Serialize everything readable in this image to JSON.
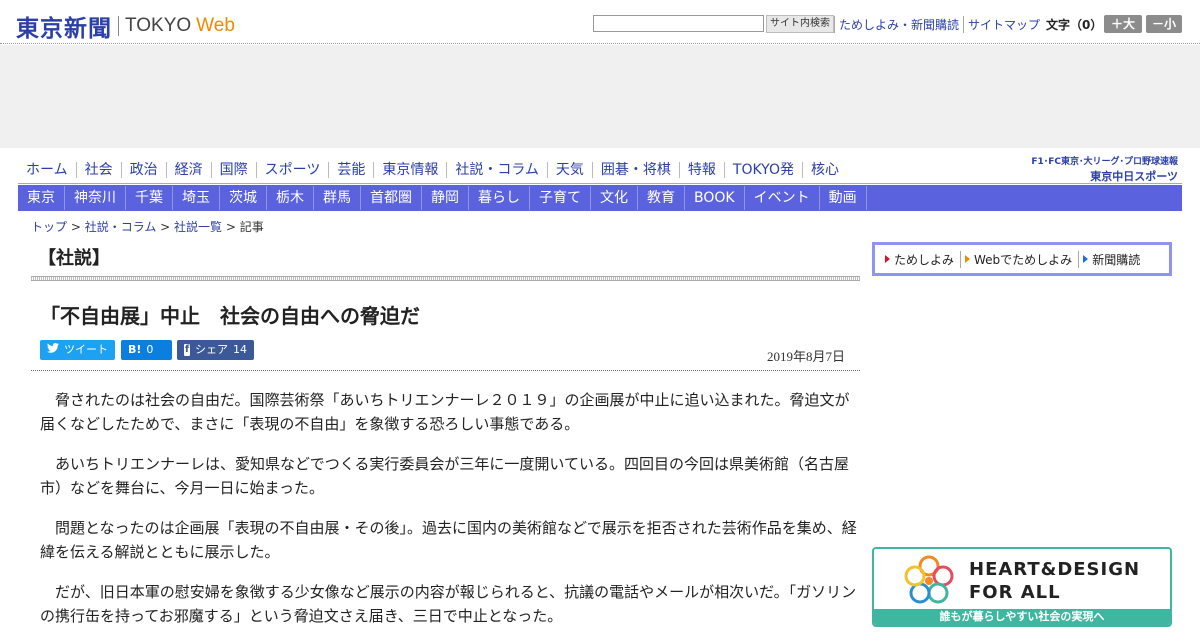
{
  "header": {
    "logo_jp": "東京新聞",
    "logo_en": "TOKYO",
    "logo_web": "Web",
    "search_button": "サイト内検索",
    "search_value": "",
    "links": [
      "ためしよみ・新聞購読",
      "サイトマップ"
    ],
    "font_size_label": "文字（0）",
    "font_plus": "＋大",
    "font_minus": "－小"
  },
  "main_nav": [
    "ホーム",
    "社会",
    "政治",
    "経済",
    "国際",
    "スポーツ",
    "芸能",
    "東京情報",
    "社説・コラム",
    "天気",
    "囲碁・将棋",
    "特報",
    "TOKYO発",
    "核心"
  ],
  "chunichi": {
    "line1": "F1･FC東京･大リーグ･プロ野球速報",
    "line2": "東京中日スポーツ"
  },
  "sub_nav": [
    "東京",
    "神奈川",
    "千葉",
    "埼玉",
    "茨城",
    "栃木",
    "群馬",
    "首都圏",
    "静岡",
    "暮らし",
    "子育て",
    "文化",
    "教育",
    "BOOK",
    "イベント",
    "動画"
  ],
  "breadcrumb": {
    "items": [
      "トップ",
      "社説・コラム",
      "社説一覧"
    ],
    "current": "記事",
    "separator": " > "
  },
  "article": {
    "section": "【社説】",
    "headline": "「不自由展」中止　社会の自由への脅迫だ",
    "date": "2019年8月7日",
    "share": {
      "tweet_label": "ツイート",
      "hatena_label": "B!",
      "hatena_count": "0",
      "facebook_icon": "f",
      "facebook_label": "シェア",
      "facebook_count": "14"
    },
    "paragraphs": [
      "脅されたのは社会の自由だ。国際芸術祭「あいちトリエンナーレ２０１９」の企画展が中止に追い込まれた。脅迫文が届くなどしたためで、まさに「表現の不自由」を象徴する恐ろしい事態である。",
      "あいちトリエンナーレは、愛知県などでつくる実行委員会が三年に一度開いている。四回目の今回は県美術館（名古屋市）などを舞台に、今月一日に始まった。",
      "問題となったのは企画展「表現の不自由展・その後」。過去に国内の美術館などで展示を拒否された芸術作品を集め、経緯を伝える解説とともに展示した。",
      "だが、旧日本軍の慰安婦を象徴する少女像など展示の内容が報じられると、抗議の電話やメールが相次いだ。「ガソリンの携行缶を持ってお邪魔する」という脅迫文さえ届き、三日で中止となった。"
    ]
  },
  "sidebar": {
    "subscribe": [
      "ためしよみ",
      "Webでためしよみ",
      "新聞購読"
    ],
    "banner": {
      "title1": "HEART&DESIGN",
      "title2": "FOR ALL",
      "footer": "誰もが暮らしやすい社会の実現へ"
    }
  },
  "colors": {
    "brand_blue": "#2a3fa8",
    "subnav_bg": "#5a62de",
    "accent_orange": "#ee8a00",
    "twitter": "#1da1f2",
    "hatena": "#0a7fe0",
    "facebook": "#3b5998",
    "banner_teal": "#3fb7a0"
  }
}
